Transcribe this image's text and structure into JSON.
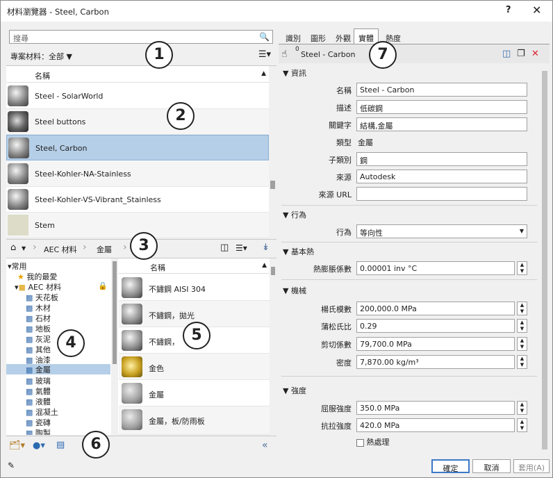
{
  "title": "材料瀏覽器 - Steel, Carbon",
  "help_label": "?",
  "close_label": "✕",
  "search": {
    "placeholder": "搜尋"
  },
  "filter": {
    "label": "專案材料：全部"
  },
  "material_list": {
    "header": "名稱",
    "items": [
      {
        "name": "Steel - SolarWorld"
      },
      {
        "name": "Steel buttons"
      },
      {
        "name": "Steel, Carbon"
      },
      {
        "name": "Steel-Kohler-NA-Stainless"
      },
      {
        "name": "Steel-Kohler-VS-Vibrant_Stainless"
      },
      {
        "name": "Stem"
      }
    ]
  },
  "breadcrumb": {
    "lib": "AEC 材料",
    "cat": "金屬"
  },
  "tree": {
    "root": "常用",
    "fav": "我的最愛",
    "aec": "AEC 材料",
    "items": [
      "天花板",
      "木材",
      "石材",
      "地板",
      "灰泥",
      "其他",
      "油漆",
      "金屬",
      "玻璃",
      "氣體",
      "液體",
      "混凝土",
      "瓷磚",
      "陶製"
    ]
  },
  "library": {
    "header": "名稱",
    "items": [
      {
        "name": "不鏽鋼 AISI 304"
      },
      {
        "name": "不鏽鋼，拋光"
      },
      {
        "name": "不鏽鋼，"
      },
      {
        "name": "金色"
      },
      {
        "name": "金屬"
      },
      {
        "name": "金屬，板/防雨板"
      }
    ]
  },
  "tabs": [
    "識別",
    "圖形",
    "外觀",
    "實體",
    "熱度"
  ],
  "asset": {
    "name": "Steel - Carbon",
    "count": "0"
  },
  "sections": {
    "info": "資訊",
    "behavior": "行為",
    "thermal": "基本熱",
    "mech": "機械",
    "strength": "強度"
  },
  "props": {
    "name_lbl": "名稱",
    "name_val": "Steel - Carbon",
    "desc_lbl": "描述",
    "desc_val": "低碳鋼",
    "kw_lbl": "關鍵字",
    "kw_val": "結構,金屬",
    "type_lbl": "類型",
    "type_val": "金屬",
    "sub_lbl": "子類別",
    "sub_val": "鋼",
    "src_lbl": "來源",
    "src_val": "Autodesk",
    "url_lbl": "來源 URL",
    "url_val": "",
    "beh_lbl": "行為",
    "beh_val": "等向性",
    "exp_lbl": "熱膨脹係數",
    "exp_val": "0.00001 inv °C",
    "young_lbl": "楊氏模數",
    "young_val": "200,000.0 MPa",
    "poisson_lbl": "蒲松氏比",
    "poisson_val": "0.29",
    "shear_lbl": "剪切係數",
    "shear_val": "79,700.0 MPa",
    "dens_lbl": "密度",
    "dens_val": "7,870.00 kg/m³",
    "yield_lbl": "屈服強度",
    "yield_val": "350.0 MPa",
    "tensile_lbl": "抗拉強度",
    "tensile_val": "420.0 MPa",
    "heat_lbl": "熱處理"
  },
  "footer": {
    "ok": "確定",
    "cancel": "取消",
    "apply": "套用(A)"
  },
  "callouts": [
    "1",
    "2",
    "3",
    "4",
    "5",
    "6",
    "7"
  ]
}
